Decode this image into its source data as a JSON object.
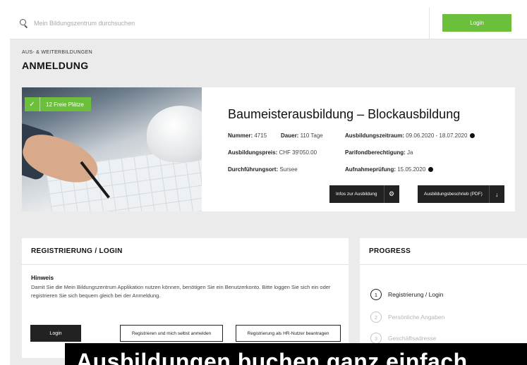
{
  "search": {
    "placeholder": "Mein Bildungszentrum durchsuchen"
  },
  "header": {
    "login_label": "Login"
  },
  "breadcrumb": "AUS- & WEITERBILDUNGEN",
  "page_title": "ANMELDUNG",
  "course": {
    "badge": "12 Freie Plätze",
    "title": "Baumeisterausbildung – Blockausbildung",
    "meta": {
      "nummer_label": "Nummer:",
      "nummer": "4715",
      "dauer_label": "Dauer:",
      "dauer": "110 Tage",
      "zeitraum_label": "Ausbildungszeitraum:",
      "zeitraum": "09.06.2020 - 18.07.2020",
      "preis_label": "Ausbildungspreis:",
      "preis": "CHF 39'050.00",
      "parifond_label": "Parifondberechtigung:",
      "parifond": "Ja",
      "ort_label": "Durchführungsort:",
      "ort": "Sursee",
      "pruefung_label": "Aufnahmeprüfung:",
      "pruefung": "15.05.2020"
    },
    "btn_infos": "Infos zur Ausbildung",
    "btn_pdf": "Ausbildungsbeschrieb (PDF)"
  },
  "registration": {
    "title": "REGISTRIERUNG / LOGIN",
    "hint_title": "Hinweis",
    "hint_text": "Damit Sie die Mein Bildungszentrum Applikation nutzen können, benötigen Sie ein Benutzerkonto. Bitte loggen Sie sich ein oder registrieren Sie sich bequem gleich bei der Anmeldung.",
    "login_label": "Login",
    "self_register_label": "Registrieren und mich selbst anmelden",
    "hr_register_label": "Registrierung als HR-Nutzer beantragen"
  },
  "progress": {
    "title": "PROGRESS",
    "steps": [
      {
        "num": "1",
        "label": "Registrierung / Login"
      },
      {
        "num": "2",
        "label": "Persönliche Angaben"
      },
      {
        "num": "3",
        "label": "Geschäftsadresse"
      }
    ]
  },
  "caption": "Ausbildungen buchen ganz einfach"
}
